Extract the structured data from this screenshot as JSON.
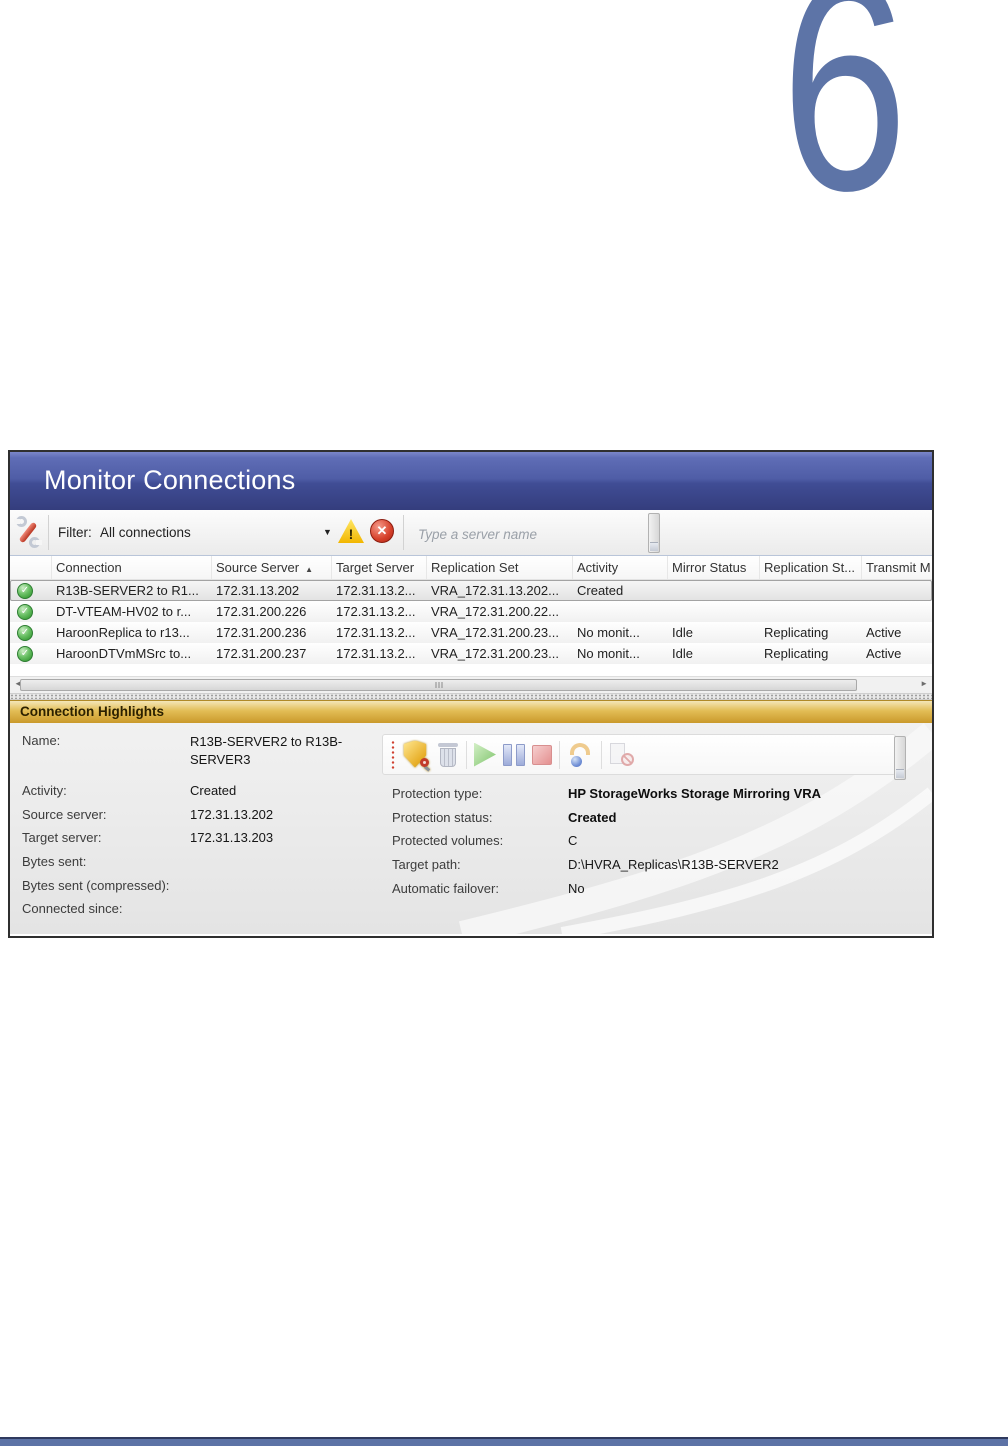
{
  "page": {
    "chapter_number": "6"
  },
  "colors": {
    "accent_blue": "#5d74a7",
    "title_bar_top": "#6b7ac2",
    "title_bar_bottom": "#343d7d",
    "highlights_gold": "#ca992b",
    "status_ok_green": "#41a23e",
    "warning_yellow": "#f2b600",
    "danger_red": "#d6402a"
  },
  "window": {
    "title": "Monitor Connections",
    "filter_bar": {
      "filter_label": "Filter:",
      "filter_value": "All connections",
      "dropdown_arrow": "▼",
      "search_placeholder": "Type a server name"
    },
    "table": {
      "columns": [
        "Connection",
        "Source Server",
        "Target Server",
        "Replication Set",
        "Activity",
        "Mirror Status",
        "Replication St...",
        "Transmit M"
      ],
      "sort_arrow": "▲",
      "rows": [
        [
          "R13B-SERVER2 to R1...",
          "172.31.13.202",
          "172.31.13.2...",
          "VRA_172.31.13.202...",
          "Created",
          "",
          "",
          ""
        ],
        [
          "DT-VTEAM-HV02 to r...",
          "172.31.200.226",
          "172.31.13.2...",
          "VRA_172.31.200.22...",
          "",
          "",
          "",
          ""
        ],
        [
          "HaroonReplica to r13...",
          "172.31.200.236",
          "172.31.13.2...",
          "VRA_172.31.200.23...",
          "No monit...",
          "Idle",
          "Replicating",
          "Active"
        ],
        [
          "HaroonDTVmMSrc to...",
          "172.31.200.237",
          "172.31.13.2...",
          "VRA_172.31.200.23...",
          "No monit...",
          "Idle",
          "Replicating",
          "Active"
        ]
      ]
    },
    "highlights": {
      "title": "Connection Highlights",
      "fields_left": [
        {
          "label": "Name:",
          "value": "R13B-SERVER2 to R13B-SERVER3"
        },
        {
          "label": "Activity:",
          "value": "Created"
        },
        {
          "label": "Source server:",
          "value": "172.31.13.202"
        },
        {
          "label": "Target server:",
          "value": "172.31.13.203"
        },
        {
          "label": "Bytes sent:",
          "value": ""
        },
        {
          "label": "Bytes sent (compressed):",
          "value": ""
        },
        {
          "label": "Connected since:",
          "value": ""
        }
      ],
      "fields_right": [
        {
          "label": "Protection type:",
          "value": "HP StorageWorks Storage Mirroring VRA"
        },
        {
          "label": "Protection status:",
          "value": "Created"
        },
        {
          "label": "Protected volumes:",
          "value": "C"
        },
        {
          "label": "Target path:",
          "value": "D:\\HVRA_Replicas\\R13B-SERVER2"
        },
        {
          "label": "Automatic failover:",
          "value": "No"
        }
      ],
      "toolbar_icons": [
        "protection-shield-icon",
        "delete-icon",
        "start-icon",
        "pause-icon",
        "stop-icon",
        "failover-icon",
        "disconnect-icon"
      ]
    }
  }
}
